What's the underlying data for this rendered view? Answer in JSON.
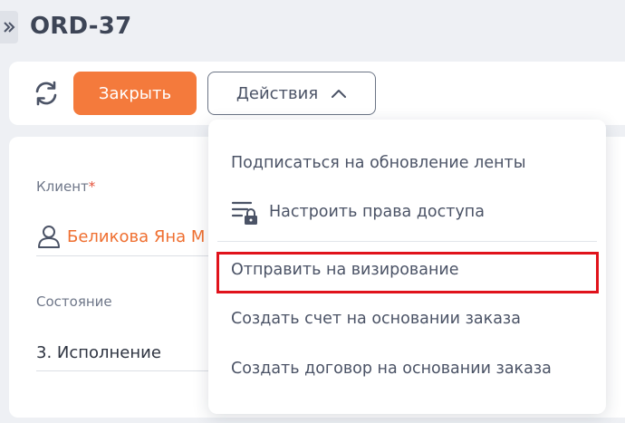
{
  "header": {
    "title": "ORD-37"
  },
  "toolbar": {
    "close_label": "Закрыть",
    "actions_label": "Действия"
  },
  "form": {
    "client_label": "Клиент",
    "client_required": "*",
    "client_value": "Беликова Яна М",
    "state_label": "Состояние",
    "state_value": "3. Исполнение"
  },
  "actions_menu": {
    "items": [
      {
        "label": "Подписаться на обновление ленты"
      },
      {
        "label": "Настроить права доступа",
        "icon": "access-rights-icon"
      },
      {
        "label": "Отправить на визирование",
        "highlighted": true
      },
      {
        "label": "Создать счет на основании заказа"
      },
      {
        "label": "Создать договор на основании заказа"
      }
    ]
  },
  "colors": {
    "accent": "#f47a3c",
    "highlight_border": "#e0121b",
    "background": "#eef0f4"
  }
}
